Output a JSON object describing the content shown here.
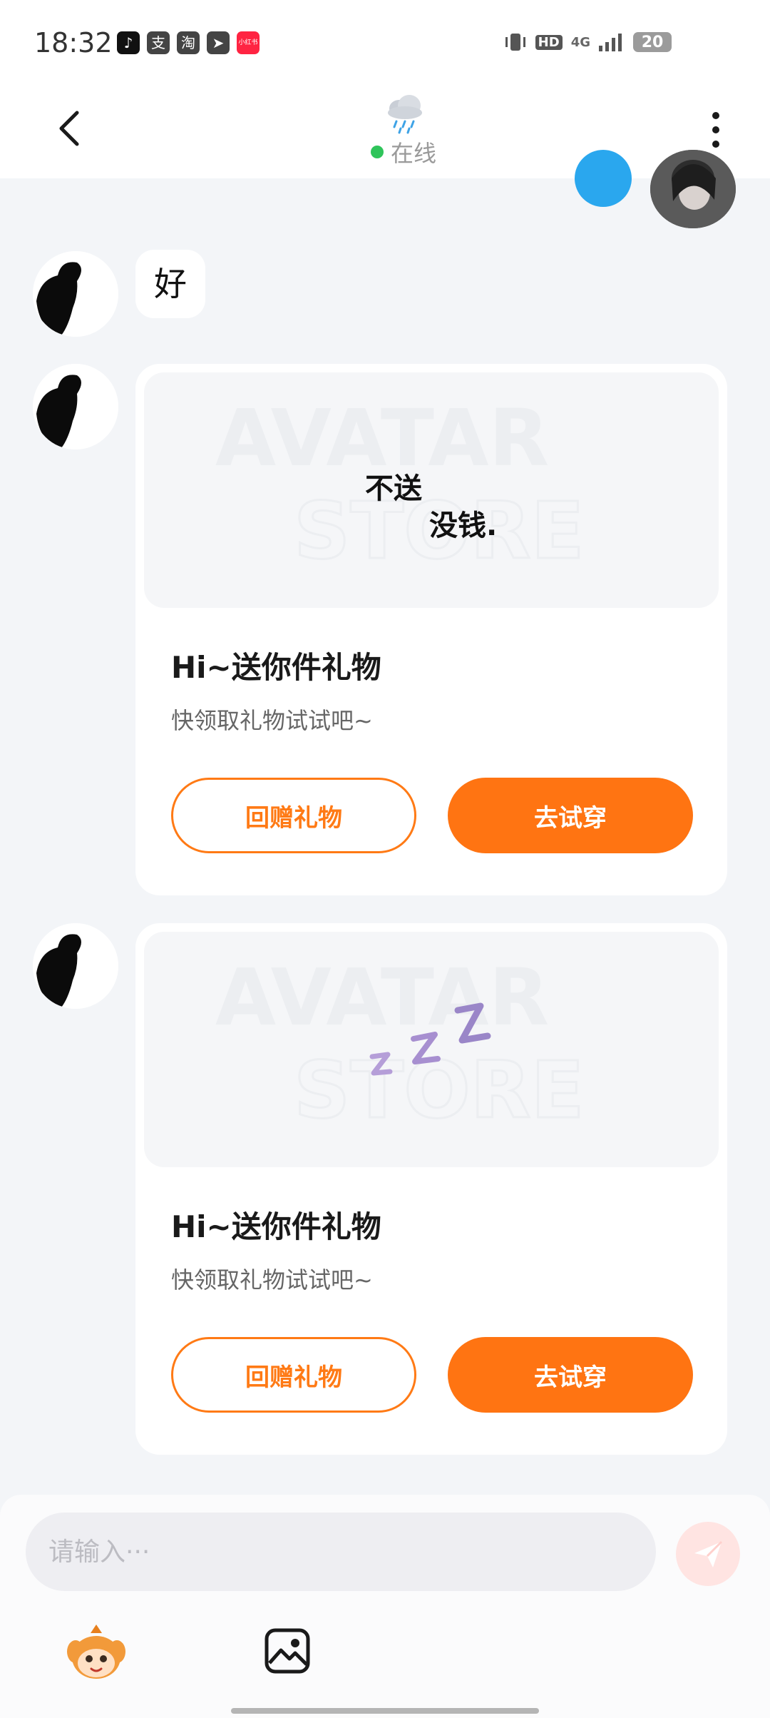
{
  "status_bar": {
    "time": "18:32",
    "app_icons": [
      {
        "name": "tiktok-icon",
        "glyph": "♪",
        "color": "#111111"
      },
      {
        "name": "alipay-icon",
        "glyph": "支",
        "color": "#444444"
      },
      {
        "name": "taobao-icon",
        "glyph": "淘",
        "color": "#444444"
      },
      {
        "name": "telegram-icon",
        "glyph": "➤",
        "color": "#444444"
      },
      {
        "name": "xiaohongshu-icon",
        "glyph": "小红书",
        "color": "#ff2442"
      }
    ],
    "hd_label": "HD",
    "network_label": "4G",
    "battery": "20"
  },
  "header": {
    "status": "在线"
  },
  "messages": {
    "text_message": "好",
    "gift_cards": [
      {
        "image_text_1": "不送",
        "image_text_2": "没钱.",
        "watermark_1": "AVATAR",
        "watermark_2": "STORE",
        "title": "Hi~送你件礼物",
        "subtitle": "快领取礼物试试吧~",
        "return_gift_label": "回赠礼物",
        "try_on_label": "去试穿"
      },
      {
        "image_text_1": "",
        "image_text_2": "",
        "watermark_1": "AVATAR",
        "watermark_2": "STORE",
        "title": "Hi~送你件礼物",
        "subtitle": "快领取礼物试试吧~",
        "return_gift_label": "回赠礼物",
        "try_on_label": "去试穿"
      }
    ]
  },
  "input": {
    "placeholder": "请输入···",
    "value": ""
  },
  "colors": {
    "accent": "#ff7412",
    "online": "#2fc45a",
    "background": "#f3f5f8"
  }
}
